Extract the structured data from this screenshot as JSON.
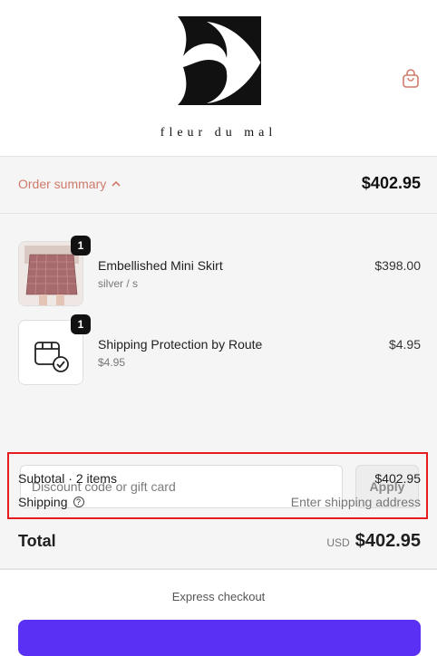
{
  "header": {
    "logo_text": "fleur  du  mal"
  },
  "summary": {
    "toggle_label": "Order summary",
    "total": "$402.95"
  },
  "items": [
    {
      "quantity": "1",
      "name": "Embellished Mini Skirt",
      "variant": "silver / s",
      "price": "$398.00"
    },
    {
      "quantity": "1",
      "name": "Shipping Protection by Route",
      "variant": "$4.95",
      "price": "$4.95"
    }
  ],
  "discount": {
    "placeholder": "Discount code or gift card",
    "apply_label": "Apply"
  },
  "totals": {
    "subtotal_label": "Subtotal · 2 items",
    "subtotal_value": "$402.95",
    "shipping_label": "Shipping",
    "shipping_value": "Enter shipping address",
    "total_label": "Total",
    "currency": "USD",
    "total_value": "$402.95"
  },
  "checkout": {
    "express_label": "Express checkout"
  },
  "colors": {
    "accent": "#d07a6a",
    "highlight": "#e81c1c",
    "pay_button": "#5a31f4"
  }
}
